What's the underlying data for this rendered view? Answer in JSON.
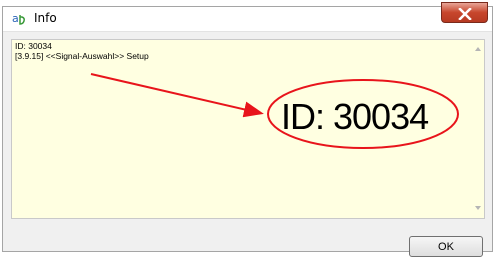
{
  "window": {
    "title": "Info",
    "close_icon": "close-icon",
    "app_icon": "info-app-icon"
  },
  "content": {
    "lines": [
      "ID: 30034",
      "[3.9.15] <<Signal-Auswahl>> Setup"
    ],
    "background_color": "#ffffe1"
  },
  "annotation": {
    "zoom_text": "ID: 30034",
    "color": "#e8141b"
  },
  "footer": {
    "ok_label": "OK"
  }
}
